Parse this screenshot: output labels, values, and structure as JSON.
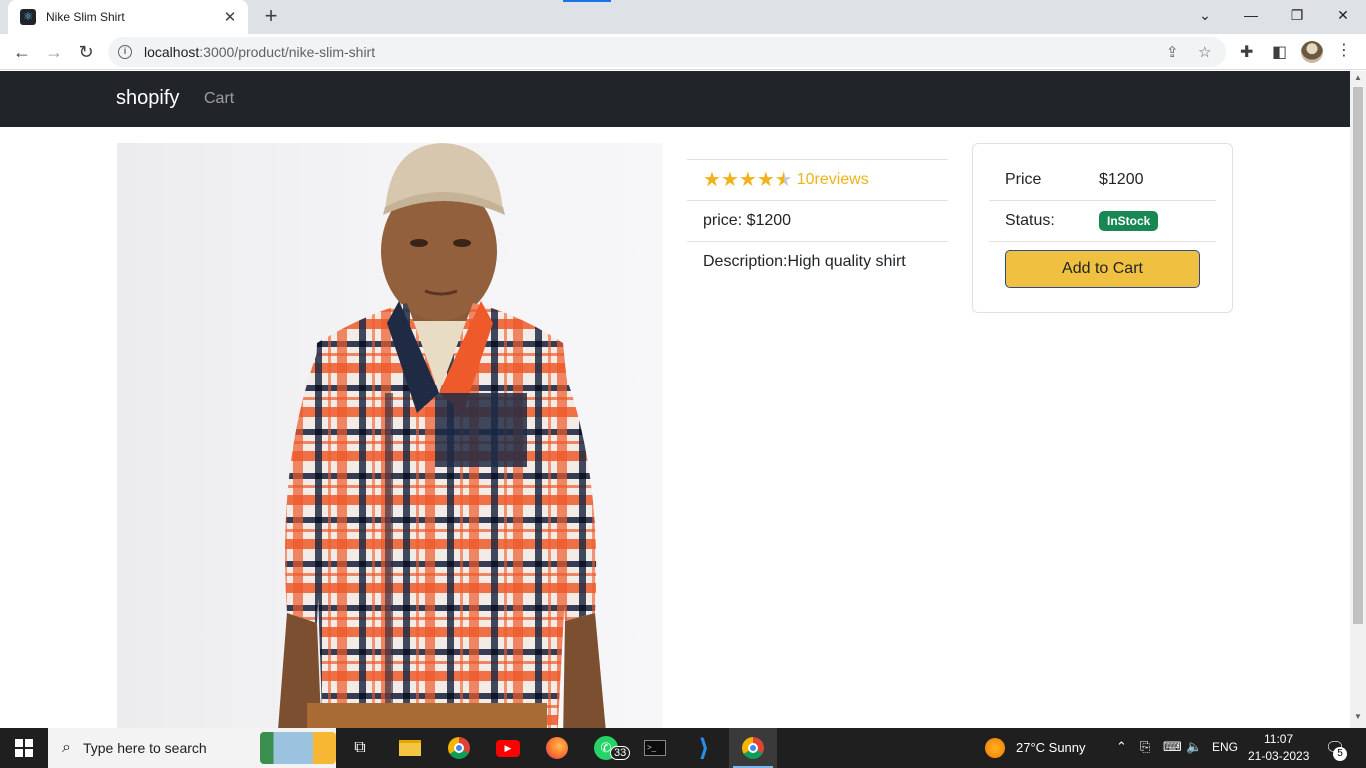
{
  "browser": {
    "tab_title": "Nike Slim Shirt",
    "url_host": "localhost",
    "url_path": ":3000/product/nike-slim-shirt"
  },
  "site": {
    "brand": "shopify",
    "nav_cart": "Cart"
  },
  "product": {
    "image_alt": "Nike Slim Shirt",
    "rating": 4.5,
    "reviews_text": "10reviews",
    "price_text": "price: $1200",
    "description_text": "Description:High quality shirt"
  },
  "cart_card": {
    "price_label": "Price",
    "price_value": "$1200",
    "status_label": "Status:",
    "status_value": "InStock",
    "add_to_cart": "Add to Cart"
  },
  "taskbar": {
    "search_placeholder": "Type here to search",
    "whatsapp_badge": "33",
    "weather": "27°C  Sunny",
    "language": "ENG",
    "time": "11:07",
    "date": "21-03-2023",
    "notifications": "5"
  },
  "colors": {
    "navbar": "#212529",
    "star": "#f0b31b",
    "badge": "#198754",
    "add_button": "#f0c040"
  }
}
